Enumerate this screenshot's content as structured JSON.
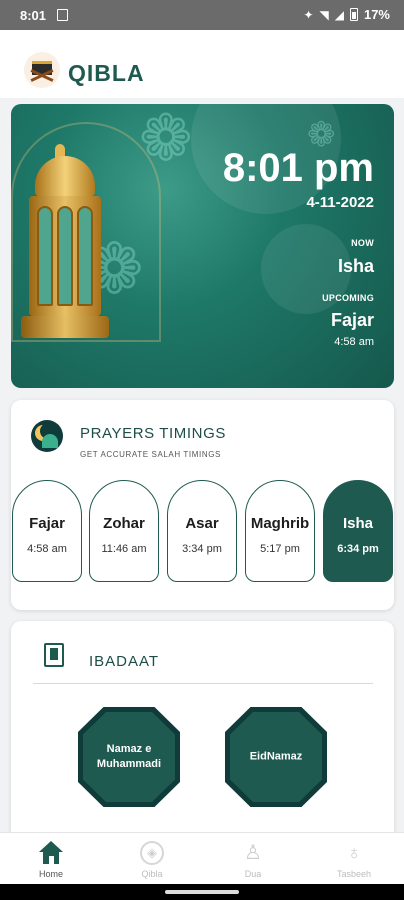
{
  "status_bar": {
    "time": "8:01",
    "battery": "17%"
  },
  "app": {
    "title": "QIBLA"
  },
  "hero": {
    "clock": "8:01 pm",
    "date": "4-11-2022",
    "now_label": "NOW",
    "now_prayer": "Isha",
    "upcoming_label": "UPCOMING",
    "upcoming_prayer": "Fajar",
    "upcoming_time": "4:58 am"
  },
  "prayer_timings": {
    "title": "PRAYERS TIMINGS",
    "subtitle": "GET ACCURATE SALAH TIMINGS",
    "items": [
      {
        "name": "Fajar",
        "time": "4:58 am"
      },
      {
        "name": "Zohar",
        "time": "11:46 am"
      },
      {
        "name": "Asar",
        "time": "3:34 pm"
      },
      {
        "name": "Maghrib",
        "time": "5:17 pm"
      },
      {
        "name": "Isha",
        "time": "6:34 pm"
      }
    ],
    "active": "Isha"
  },
  "ibadaat": {
    "title": "IBADAAT",
    "buttons": [
      {
        "label": "Namaz e Muhammadi"
      },
      {
        "label": "EidNamaz"
      }
    ]
  },
  "bottom_nav": {
    "items": [
      {
        "label": "Home",
        "icon": "home-icon"
      },
      {
        "label": "Qibla",
        "icon": "qibla-icon"
      },
      {
        "label": "Dua",
        "icon": "dua-icon"
      },
      {
        "label": "Tasbeeh",
        "icon": "tasbeeh-icon"
      }
    ],
    "active": "Home"
  },
  "colors": {
    "primary": "#1e5a50",
    "dark": "#0f3b3a",
    "accent_gold": "#e3b656"
  }
}
